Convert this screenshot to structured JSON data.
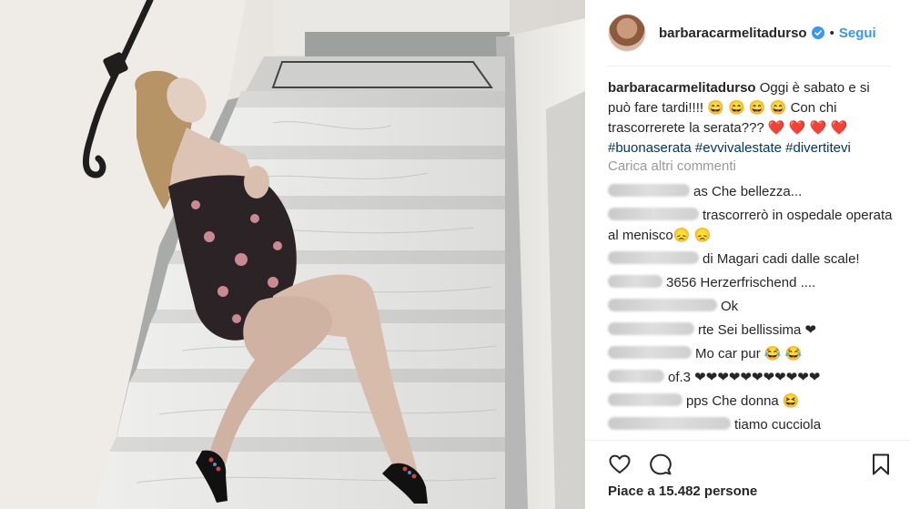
{
  "post": {
    "username": "barbaracarmelitadurso",
    "verified_icon": "verified-badge-icon",
    "separator": "•",
    "follow_label": "Segui",
    "caption_text": "Oggi è sabato e si può fare tardi!!!! 😄 😄 😄 😄  Con chi trascorrerete la serata??? ❤️ ❤️ ❤️ ❤️",
    "hashtags": [
      "#buonaserata",
      "#evvivalestate",
      "#divertitevi"
    ],
    "load_more_label": "Carica altri commenti",
    "likes_label": "Piace a 15.482 persone"
  },
  "comments": [
    {
      "user_visible": "",
      "text": "as Che bellezza..."
    },
    {
      "user_visible": "",
      "text": "trascorrerò in ospedale operata al menisco😞 😞"
    },
    {
      "user_visible": "",
      "text": "di Magari cadi dalle scale!"
    },
    {
      "user_visible": "",
      "text": "3656 Herzerfrischend ...."
    },
    {
      "user_visible": "",
      "text": "Ok"
    },
    {
      "user_visible": "",
      "text": "rte Sei bellissima ❤"
    },
    {
      "user_visible": "",
      "text": "Mo car pur 😂 😂"
    },
    {
      "user_visible": "",
      "text": "of.3 ❤❤❤❤❤❤❤❤❤❤❤"
    },
    {
      "user_visible": "",
      "text": "pps Che donna 😆"
    },
    {
      "user_visible": "",
      "text": "tiamo cucciola"
    }
  ],
  "icons": {
    "like": "heart-outline-icon",
    "comment": "comment-bubble-icon",
    "save": "bookmark-icon"
  },
  "colors": {
    "link_blue": "#3897f0",
    "hashtag_blue": "#003569",
    "muted_grey": "#999999",
    "text": "#262626"
  }
}
